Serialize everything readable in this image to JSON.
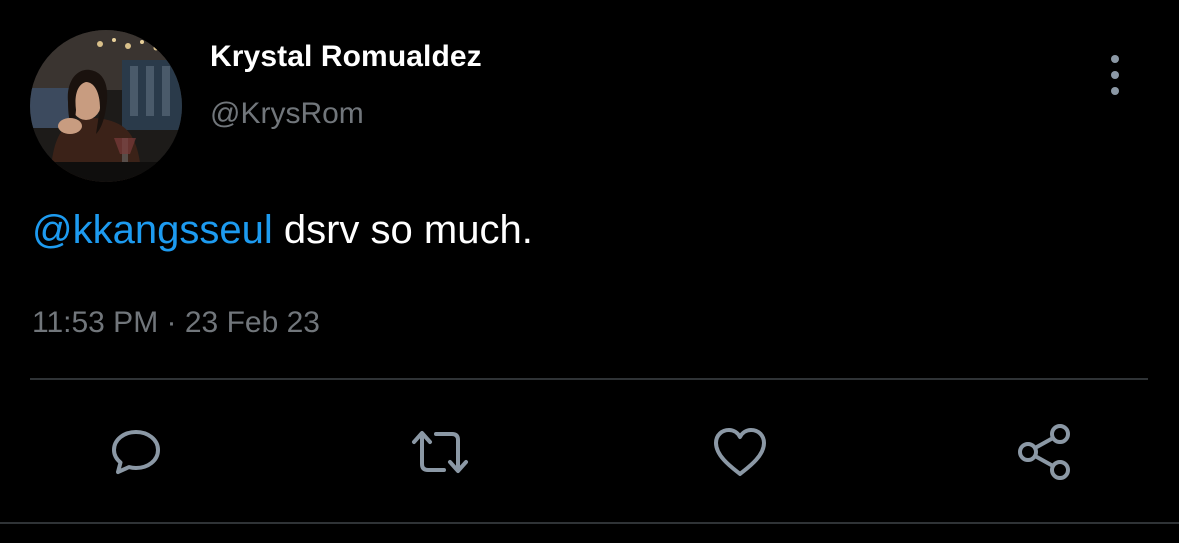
{
  "tweet": {
    "author": {
      "display_name": "Krystal Romualdez",
      "handle": "@KrysRom",
      "avatar": "profile-photo"
    },
    "text": {
      "mention": "@kkangsseul",
      "body": " dsrv so much."
    },
    "meta": {
      "time": "11:53 PM",
      "separator": " · ",
      "date": "23 Feb 23"
    }
  },
  "menu": {
    "icon": "more-vertical-icon"
  },
  "actions": [
    {
      "name": "reply",
      "icon": "comment-icon"
    },
    {
      "name": "retweet",
      "icon": "retweet-icon"
    },
    {
      "name": "like",
      "icon": "heart-icon"
    },
    {
      "name": "share",
      "icon": "share-icon"
    }
  ],
  "colors": {
    "background": "#000000",
    "mention": "#1d9bf0",
    "secondary_text": "#71767b",
    "icon": "#8b98a5",
    "divider": "#2f3336"
  }
}
